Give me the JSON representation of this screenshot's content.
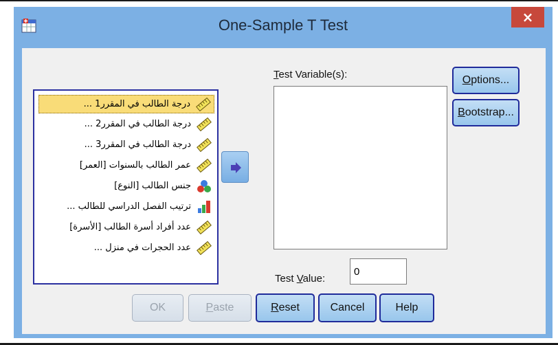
{
  "window": {
    "title": "One-Sample T Test",
    "close_glyph": "×",
    "app_icon": "spss-dialog-icon"
  },
  "variables": [
    {
      "label": "درجة الطالب في المقرر1 ...",
      "icon": "ruler-scale-icon",
      "selected": true
    },
    {
      "label": "درجة الطالب في المقرر2 ...",
      "icon": "ruler-scale-icon",
      "selected": false
    },
    {
      "label": "درجة الطالب في المقرر3 ...",
      "icon": "ruler-scale-icon",
      "selected": false
    },
    {
      "label": "عمر الطالب بالسنوات [العمر]",
      "icon": "ruler-scale-icon",
      "selected": false
    },
    {
      "label": "جنس الطالب [النوع]",
      "icon": "nominal-circles-icon",
      "selected": false
    },
    {
      "label": "ترتيب الفصل الدراسي للطالب ...",
      "icon": "ordinal-bars-icon",
      "selected": false
    },
    {
      "label": "عدد أفراد أسرة الطالب [الأسرة]",
      "icon": "ruler-scale-icon",
      "selected": false
    },
    {
      "label": "عدد الحجرات في منزل ...",
      "icon": "ruler-scale-icon",
      "selected": false
    }
  ],
  "move_button": {
    "icon": "move-right-arrow-icon"
  },
  "test_variables": {
    "label_mnemonic": "T",
    "label_rest": "est Variable(s):"
  },
  "test_value": {
    "label_before": "Test ",
    "label_mnemonic": "V",
    "label_after": "alue:",
    "value": "0"
  },
  "buttons": {
    "options_mnemonic": "O",
    "options_rest": "ptions...",
    "bootstrap_mnemonic": "B",
    "bootstrap_rest": "ootstrap...",
    "ok": "OK",
    "paste_mnemonic": "P",
    "paste_rest": "aste",
    "reset_mnemonic": "R",
    "reset_rest": "eset",
    "cancel": "Cancel",
    "help": "Help"
  },
  "colors": {
    "window_frame": "#7cb0e4",
    "close_button": "#c7483b",
    "selection": "#f9dc78",
    "focus_border": "#1f2a9a"
  }
}
